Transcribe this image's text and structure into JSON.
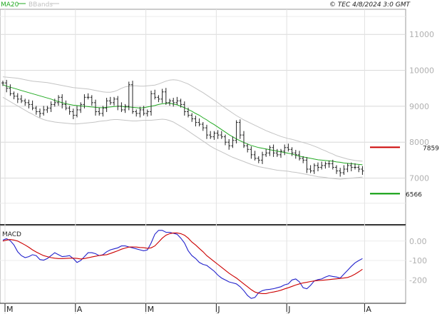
{
  "header": {
    "legend": [
      {
        "label": "MA20",
        "color": "#22aa22"
      },
      {
        "label": "BBands",
        "color": "#c0c0c0"
      }
    ],
    "copyright": "© TEC 4/8/2024 3:0 GMT"
  },
  "chart_data": [
    {
      "type": "ohlc",
      "ylim": [
        5700,
        11700
      ],
      "yticks": [
        {
          "value": 11000,
          "label": "11000"
        },
        {
          "value": 10000,
          "label": "10000"
        },
        {
          "value": 9000,
          "label": "9000"
        },
        {
          "value": 8000,
          "label": "8000"
        },
        {
          "value": 7000,
          "label": "7000"
        }
      ],
      "xticks": [
        {
          "index": 0,
          "label": "M"
        },
        {
          "index": 19,
          "label": "A"
        },
        {
          "index": 38,
          "label": "M"
        },
        {
          "index": 57,
          "label": "J"
        },
        {
          "index": 76,
          "label": "J"
        },
        {
          "index": 97,
          "label": "A"
        }
      ],
      "close": [
        9650,
        9500,
        9350,
        9280,
        9200,
        9150,
        9100,
        9050,
        8950,
        8850,
        8800,
        8900,
        8950,
        9050,
        9100,
        9250,
        9050,
        8950,
        8850,
        8750,
        8900,
        9050,
        9250,
        9250,
        9100,
        8850,
        8800,
        8950,
        9150,
        9100,
        9200,
        9000,
        8900,
        9000,
        9600,
        8850,
        8800,
        8900,
        8800,
        8850,
        9350,
        9250,
        9200,
        9400,
        9100,
        9150,
        9100,
        9150,
        9050,
        8850,
        8750,
        8650,
        8550,
        8500,
        8400,
        8200,
        8150,
        8250,
        8200,
        8150,
        8000,
        7900,
        8050,
        8550,
        8200,
        7900,
        7800,
        7650,
        7550,
        7500,
        7650,
        7700,
        7850,
        7700,
        7650,
        7750,
        7850,
        7800,
        7700,
        7650,
        7550,
        7500,
        7250,
        7200,
        7350,
        7300,
        7350,
        7400,
        7400,
        7300,
        7200,
        7150,
        7250,
        7350,
        7300,
        7300,
        7250,
        7200
      ],
      "ma20": [
        9600,
        9560,
        9530,
        9500,
        9470,
        9440,
        9410,
        9380,
        9350,
        9320,
        9290,
        9260,
        9230,
        9200,
        9160,
        9130,
        9100,
        9070,
        9050,
        9030,
        9020,
        9010,
        9000,
        8990,
        8980,
        8970,
        8960,
        8960,
        8970,
        8980,
        8990,
        9000,
        9000,
        8980,
        8980,
        8970,
        8960,
        8950,
        8960,
        8980,
        9000,
        9020,
        9050,
        9070,
        9080,
        9090,
        9060,
        9040,
        9000,
        8960,
        8910,
        8860,
        8800,
        8750,
        8680,
        8620,
        8550,
        8490,
        8420,
        8350,
        8280,
        8210,
        8150,
        8090,
        8040,
        7990,
        7950,
        7910,
        7880,
        7850,
        7830,
        7810,
        7790,
        7770,
        7750,
        7730,
        7710,
        7690,
        7670,
        7640,
        7610,
        7590,
        7570,
        7550,
        7530,
        7510,
        7500,
        7490,
        7480,
        7470,
        7450,
        7440,
        7420,
        7410,
        7400,
        7390,
        7380,
        7370
      ],
      "bb_upper": [
        9820,
        9810,
        9800,
        9790,
        9780,
        9760,
        9740,
        9720,
        9700,
        9690,
        9680,
        9670,
        9660,
        9640,
        9620,
        9600,
        9580,
        9560,
        9540,
        9520,
        9510,
        9500,
        9490,
        9480,
        9460,
        9440,
        9420,
        9400,
        9390,
        9390,
        9410,
        9450,
        9500,
        9540,
        9560,
        9570,
        9570,
        9560,
        9560,
        9570,
        9580,
        9590,
        9620,
        9660,
        9700,
        9730,
        9740,
        9730,
        9700,
        9660,
        9620,
        9560,
        9500,
        9440,
        9380,
        9310,
        9240,
        9170,
        9100,
        9020,
        8950,
        8880,
        8810,
        8740,
        8680,
        8620,
        8570,
        8520,
        8470,
        8420,
        8370,
        8320,
        8280,
        8240,
        8200,
        8160,
        8130,
        8100,
        8080,
        8050,
        8020,
        7990,
        7960,
        7930,
        7890,
        7850,
        7800,
        7760,
        7710,
        7670,
        7620,
        7590,
        7560,
        7530,
        7510,
        7490,
        7480,
        7470
      ],
      "bb_lower": [
        9250,
        9190,
        9130,
        9070,
        9010,
        8950,
        8890,
        8830,
        8780,
        8720,
        8670,
        8630,
        8600,
        8580,
        8560,
        8550,
        8540,
        8530,
        8520,
        8510,
        8510,
        8520,
        8530,
        8540,
        8550,
        8560,
        8580,
        8590,
        8600,
        8620,
        8630,
        8630,
        8620,
        8610,
        8600,
        8590,
        8590,
        8600,
        8610,
        8610,
        8610,
        8620,
        8630,
        8640,
        8630,
        8600,
        8560,
        8500,
        8440,
        8380,
        8310,
        8240,
        8170,
        8100,
        8030,
        7960,
        7890,
        7830,
        7780,
        7730,
        7680,
        7630,
        7580,
        7540,
        7500,
        7460,
        7420,
        7380,
        7350,
        7320,
        7300,
        7280,
        7260,
        7240,
        7220,
        7210,
        7200,
        7190,
        7170,
        7160,
        7140,
        7120,
        7100,
        7080,
        7060,
        7040,
        7030,
        7020,
        7000,
        6990,
        6980,
        6970,
        6980,
        6990,
        7000,
        7010,
        7020,
        7030
      ],
      "levels": [
        {
          "value": 7859,
          "label": "7859",
          "color": "#cc0000"
        },
        {
          "value": 6566,
          "label": "6566",
          "color": "#009900"
        }
      ]
    },
    {
      "type": "line",
      "title": "MACD",
      "ylim": [
        -320,
        80
      ],
      "yticks": [
        {
          "value": 0,
          "label": "0.00"
        },
        {
          "value": -100,
          "label": "-100"
        },
        {
          "value": -200,
          "label": "-200"
        }
      ],
      "series": [
        {
          "color": "#2222cc",
          "values": [
            5,
            12,
            2,
            -20,
            -55,
            -75,
            -85,
            -80,
            -70,
            -75,
            -95,
            -98,
            -90,
            -75,
            -60,
            -70,
            -80,
            -78,
            -75,
            -90,
            -110,
            -100,
            -80,
            -60,
            -60,
            -65,
            -75,
            -70,
            -55,
            -45,
            -40,
            -35,
            -25,
            -25,
            -30,
            -35,
            -40,
            -45,
            -50,
            -45,
            -10,
            35,
            55,
            55,
            45,
            45,
            40,
            35,
            15,
            -10,
            -50,
            -75,
            -90,
            -110,
            -120,
            -125,
            -140,
            -155,
            -175,
            -190,
            -200,
            -210,
            -215,
            -220,
            -235,
            -255,
            -280,
            -295,
            -290,
            -265,
            -255,
            -250,
            -248,
            -245,
            -240,
            -235,
            -225,
            -220,
            -200,
            -195,
            -210,
            -240,
            -245,
            -228,
            -205,
            -198,
            -195,
            -185,
            -178,
            -182,
            -185,
            -190,
            -170,
            -150,
            -130,
            -112,
            -100,
            -90
          ]
        },
        {
          "color": "#cc0000",
          "values": [
            0,
            5,
            8,
            5,
            0,
            -10,
            -20,
            -32,
            -45,
            -56,
            -66,
            -75,
            -80,
            -85,
            -88,
            -90,
            -90,
            -89,
            -88,
            -88,
            -89,
            -92,
            -90,
            -86,
            -82,
            -78,
            -74,
            -72,
            -70,
            -64,
            -57,
            -50,
            -42,
            -36,
            -31,
            -30,
            -31,
            -33,
            -34,
            -37,
            -35,
            -25,
            -5,
            15,
            30,
            38,
            42,
            42,
            38,
            30,
            15,
            -5,
            -20,
            -38,
            -55,
            -75,
            -90,
            -105,
            -120,
            -135,
            -150,
            -165,
            -178,
            -190,
            -205,
            -220,
            -235,
            -250,
            -262,
            -268,
            -270,
            -270,
            -265,
            -262,
            -258,
            -253,
            -246,
            -240,
            -233,
            -226,
            -220,
            -215,
            -212,
            -208,
            -205,
            -203,
            -202,
            -200,
            -198,
            -196,
            -194,
            -192,
            -190,
            -187,
            -180,
            -170,
            -158,
            -145
          ]
        }
      ]
    }
  ]
}
